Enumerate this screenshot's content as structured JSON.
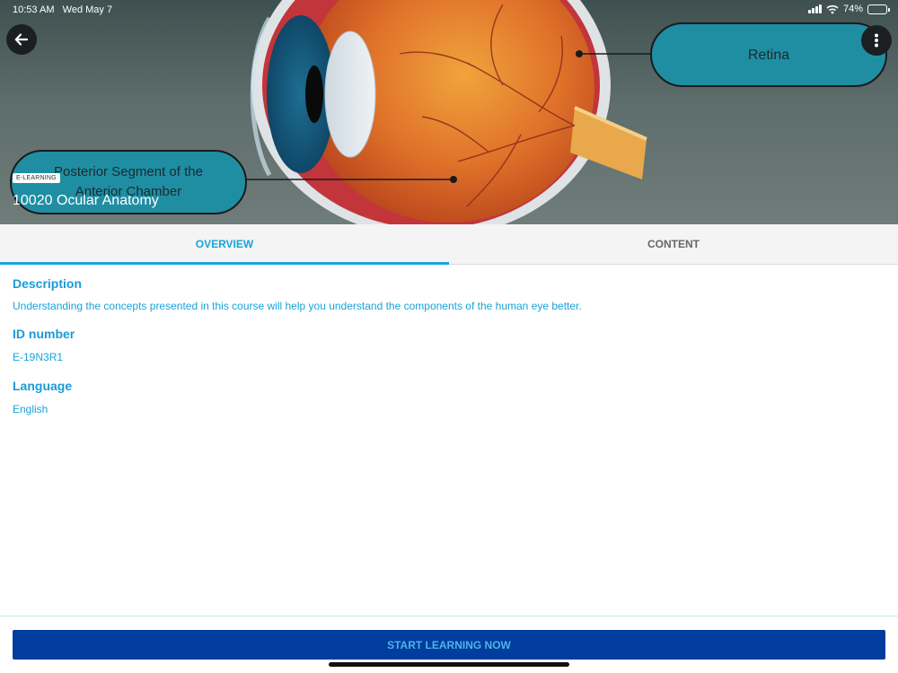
{
  "status_bar": {
    "time": "10:53 AM",
    "date": "Wed May 7",
    "battery": "74%",
    "battery_level": 0.74
  },
  "hero": {
    "badge": "E-LEARNING",
    "title": "10020 Ocular Anatomy",
    "label_retina": "Retina",
    "label_posterior_line1": "Posterior Segment of the",
    "label_posterior_line2": "Anterior Chamber"
  },
  "tabs": [
    {
      "label": "OVERVIEW",
      "active": true
    },
    {
      "label": "CONTENT",
      "active": false
    }
  ],
  "overview": {
    "description_heading": "Description",
    "description_text": "Understanding the concepts presented in this course will help you understand the components of the human eye better.",
    "id_heading": "ID number",
    "id_value": "E-19N3R1",
    "language_heading": "Language",
    "language_value": "English"
  },
  "footer": {
    "start_label": "START LEARNING NOW"
  },
  "icons": {
    "back": "arrow-left-icon",
    "more": "more-vertical-icon"
  },
  "colors": {
    "accent": "#1aa3d9",
    "primary_button": "#003d9e",
    "button_text": "#4fb3e8"
  }
}
